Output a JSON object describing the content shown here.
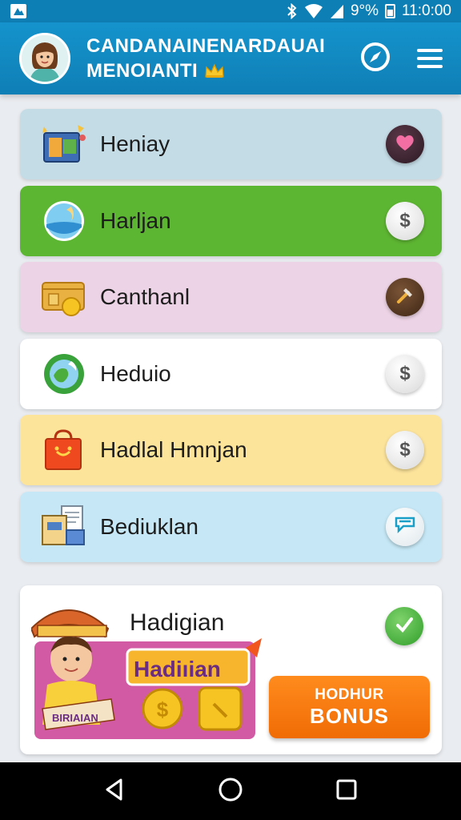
{
  "status_bar": {
    "battery": "9°%",
    "time": "11:0:00"
  },
  "header": {
    "title_line1": "CANDANAINENARDAUAI",
    "title_line2": "MENOIANTI",
    "icons": [
      "avatar",
      "crown-icon",
      "compass-icon",
      "menu-icon"
    ]
  },
  "rows": [
    {
      "label": "Heniay",
      "bg": "#c4dce6",
      "icon": "toys-icon",
      "action_icon": "heart-icon"
    },
    {
      "label": "Harljan",
      "bg": "#5db632",
      "icon": "beach-icon",
      "action_icon": "dollar-icon"
    },
    {
      "label": "Canthanl",
      "bg": "#ecd3e5",
      "icon": "wallet-icon",
      "action_icon": "tools-icon"
    },
    {
      "label": "Heduio",
      "bg": "#ffffff",
      "icon": "globe-icon",
      "action_icon": "dollar-icon"
    },
    {
      "label": "Hadlal Hmnjan",
      "bg": "#fde49b",
      "icon": "gift-bag-icon",
      "action_icon": "dollar-icon"
    },
    {
      "label": "Bediuklan",
      "bg": "#c6e8f6",
      "icon": "documents-icon",
      "action_icon": "chat-icon"
    }
  ],
  "bonus": {
    "title": "Hadigian",
    "banner": "Hadiıian",
    "scroll_text": "BIRIAIAN",
    "button_line1": "HODHUR",
    "button_line2": "BONUS"
  },
  "coin_symbol": "$",
  "nav": [
    "back-icon",
    "home-icon",
    "recents-icon"
  ]
}
